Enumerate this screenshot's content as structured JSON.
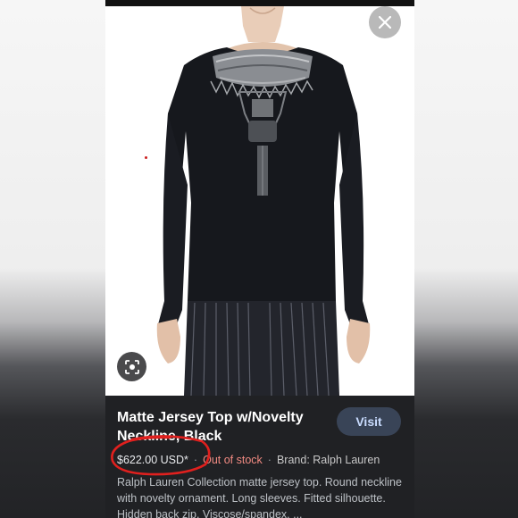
{
  "overlay": {
    "close_icon": "close-icon",
    "lens_icon": "lens-icon"
  },
  "product": {
    "title": "Matte Jersey Top w/Novelty Neckline, Black",
    "visit_label": "Visit",
    "price": "$622.00 USD*",
    "separator": "·",
    "stock_status": "Out of stock",
    "brand": "Brand: Ralph Lauren",
    "description": "Ralph Lauren Collection matte jersey top. Round neckline with novelty ornament. Long sleeves. Fitted silhouette. Hidden back zip. Viscose/spandex. ..."
  },
  "colors": {
    "panel_bg": "#202124",
    "visit_bg": "#394457",
    "visit_text": "#c9dcff",
    "out_of_stock": "#f28b82",
    "annotation": "#e0201e"
  }
}
